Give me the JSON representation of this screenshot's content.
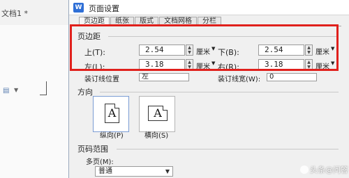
{
  "document": {
    "tab_title": "文档1 *"
  },
  "dialog": {
    "app_icon": "W",
    "title": "页面设置",
    "tabs": [
      {
        "label": "页边距",
        "active": true
      },
      {
        "label": "纸张",
        "active": false
      },
      {
        "label": "版式",
        "active": false
      },
      {
        "label": "文档网格",
        "active": false
      },
      {
        "label": "分栏",
        "active": false
      }
    ],
    "margins": {
      "group_label": "页边距",
      "top": {
        "label": "上(T):",
        "value": "2.54",
        "unit": "厘米"
      },
      "bottom": {
        "label": "下(B):",
        "value": "2.54",
        "unit": "厘米"
      },
      "left": {
        "label": "左(L):",
        "value": "3.18",
        "unit": "厘米"
      },
      "right": {
        "label": "右(R):",
        "value": "3.18",
        "unit": "厘米"
      },
      "gutter_position": {
        "label": "装订线位置",
        "value": "左"
      },
      "gutter": {
        "label": "装订线宽(W):",
        "value": "0"
      }
    },
    "orientation": {
      "group_label": "方向",
      "portrait": {
        "label": "纵向(P)",
        "glyph": "A",
        "selected": true
      },
      "landscape": {
        "label": "横向(S)",
        "glyph": "A",
        "selected": false
      }
    },
    "pages": {
      "group_label": "页码范围",
      "multiple_label": "多页(M):",
      "multiple_value": "普通"
    }
  },
  "watermark": {
    "text": "头条@问答"
  },
  "colors": {
    "highlight": "#e0201c",
    "app_icon": "#2f6fd6"
  }
}
